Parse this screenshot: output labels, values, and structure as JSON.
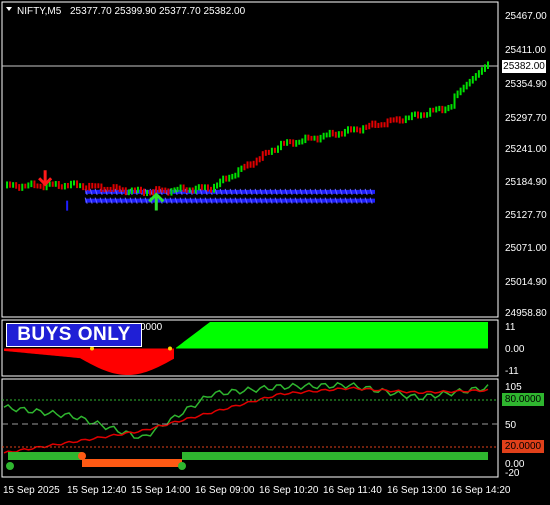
{
  "header": {
    "symbol_label": "NIFTY,M5",
    "ohlc": "25377.70 25399.90 25377.70 25382.00"
  },
  "price_axis": [
    "25467.00",
    "25411.00",
    "25354.90",
    "25297.70",
    "25241.00",
    "25184.90",
    "25127.70",
    "25071.00",
    "25014.90",
    "24958.80"
  ],
  "current_price": "25382.00",
  "osc1": {
    "banner": "BUYS ONLY",
    "partial_value": "0000",
    "axis": [
      "11",
      "0.00",
      "-11"
    ]
  },
  "osc2": {
    "axis": [
      "105",
      "50",
      "0.00",
      "-20"
    ],
    "level_high": "80.0000",
    "level_low": "20.0000"
  },
  "time_axis": [
    "15 Sep 2025",
    "15 Sep 12:40",
    "15 Sep 14:00",
    "16 Sep 09:00",
    "16 Sep 10:20",
    "16 Sep 11:40",
    "16 Sep 13:00",
    "16 Sep 14:20"
  ],
  "colors": {
    "up_bar": "#00e000",
    "down_bar": "#e00000",
    "band": "#1e1eff",
    "hist_up": "#00ff00",
    "hist_down": "#ff0000",
    "k_line": "#2fb62f",
    "d_line": "#e00000",
    "state_up": "#2fb62f",
    "state_down": "#ff5a14"
  },
  "chart_data": [
    {
      "type": "line",
      "title": "NIFTY,M5",
      "ylim": [
        24958.8,
        25467.0
      ],
      "x": [
        "15 Sep 2025",
        "15 Sep 12:40",
        "15 Sep 14:00",
        "16 Sep 09:00",
        "16 Sep 10:20",
        "16 Sep 11:40",
        "16 Sep 13:00",
        "16 Sep 14:20"
      ],
      "series": [
        {
          "values": [
            25175,
            25177,
            25165,
            25172,
            25246,
            25270,
            25297,
            25330
          ]
        }
      ],
      "signals": [
        {
          "type": "sell",
          "x": "15 Sep 12:40",
          "price": 25185
        },
        {
          "type": "buy",
          "x": "15 Sep 14:00",
          "price": 25140
        }
      ],
      "band": [
        25150,
        25165
      ]
    },
    {
      "type": "area",
      "ylim": [
        -11,
        11
      ],
      "series": [
        {
          "values": [
            0,
            -2,
            -10,
            0,
            11,
            11,
            11,
            11
          ]
        }
      ]
    },
    {
      "type": "line",
      "ylim": [
        -20,
        105
      ],
      "levels": [
        80,
        20
      ],
      "series": [
        {
          "values": [
            72,
            60,
            30,
            90,
            100,
            102,
            85,
            99
          ]
        },
        {
          "values": [
            10,
            25,
            40,
            65,
            90,
            98,
            92,
            95
          ]
        }
      ]
    }
  ]
}
